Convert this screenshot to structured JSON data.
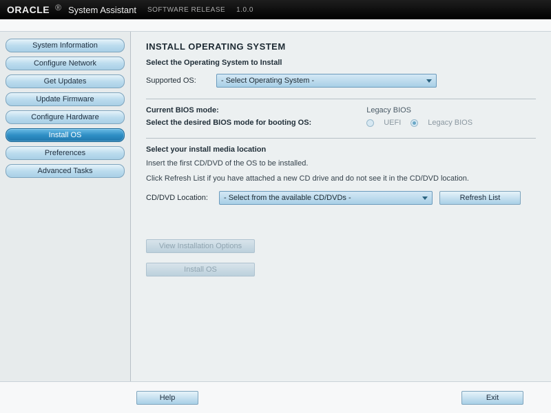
{
  "header": {
    "brand": "ORACLE",
    "title": "System Assistant",
    "release_label": "SOFTWARE RELEASE",
    "release_version": "1.0.0"
  },
  "sidebar": {
    "items": [
      {
        "label": "System Information",
        "active": false
      },
      {
        "label": "Configure Network",
        "active": false
      },
      {
        "label": "Get Updates",
        "active": false
      },
      {
        "label": "Update Firmware",
        "active": false
      },
      {
        "label": "Configure Hardware",
        "active": false
      },
      {
        "label": "Install OS",
        "active": true
      },
      {
        "label": "Preferences",
        "active": false
      },
      {
        "label": "Advanced Tasks",
        "active": false
      }
    ]
  },
  "main": {
    "title": "INSTALL OPERATING SYSTEM",
    "select_os_heading": "Select the Operating System to Install",
    "supported_os_label": "Supported OS:",
    "supported_os_placeholder": "- Select Operating System -",
    "bios": {
      "current_label": "Current BIOS mode:",
      "desired_label": "Select the desired BIOS mode for booting OS:",
      "current_value": "Legacy BIOS",
      "options": {
        "uefi": "UEFI",
        "legacy": "Legacy BIOS"
      },
      "selected": "legacy"
    },
    "media": {
      "heading": "Select your install media location",
      "line1": "Insert the first CD/DVD of the OS to be installed.",
      "line2": "Click Refresh List if you have attached a new CD drive and do not see it in the CD/DVD location.",
      "location_label": "CD/DVD Location:",
      "location_placeholder": "- Select from the available CD/DVDs -",
      "refresh_label": "Refresh List"
    },
    "buttons": {
      "view_options": "View Installation Options",
      "install_os": "Install OS"
    }
  },
  "footer": {
    "help": "Help",
    "exit": "Exit"
  }
}
